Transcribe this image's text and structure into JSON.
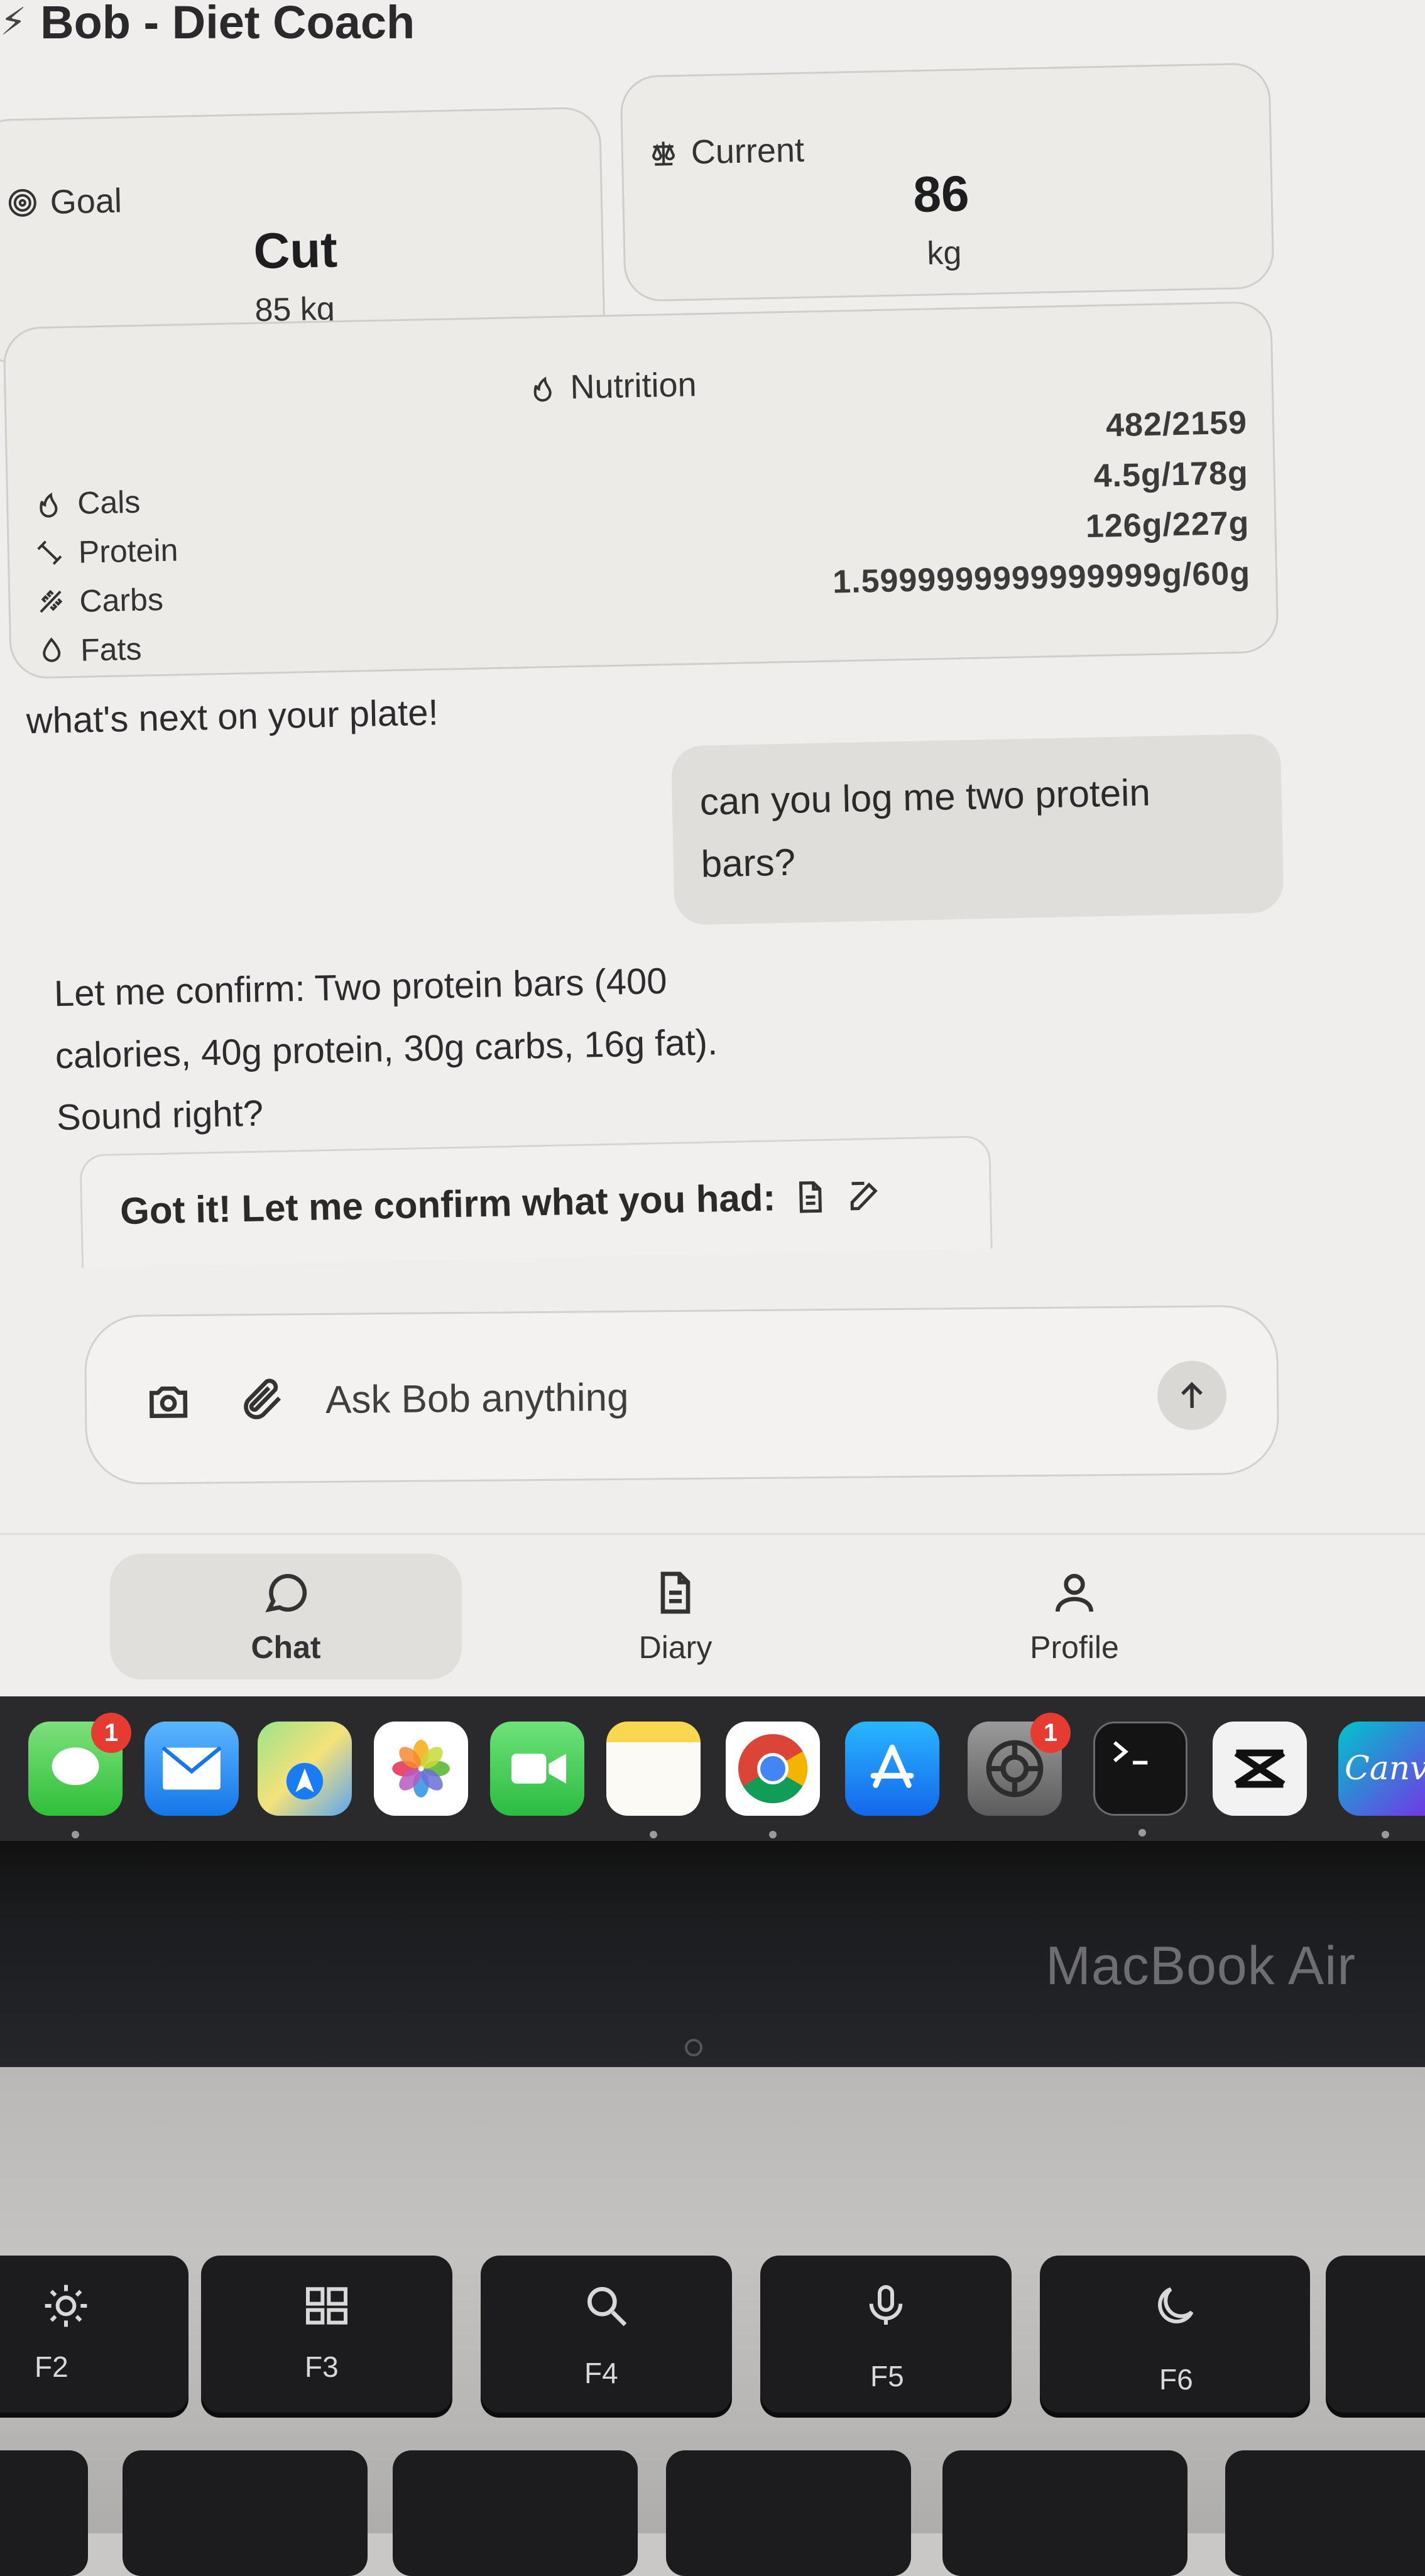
{
  "app": {
    "title": "Bob - Diet Coach"
  },
  "goal": {
    "label": "Goal",
    "value": "Cut",
    "weight": "85 kg"
  },
  "current": {
    "label": "Current",
    "value": "86",
    "unit": "kg"
  },
  "nutrition": {
    "label": "Nutrition",
    "rows": [
      {
        "name": "Cals",
        "value": "482/2159"
      },
      {
        "name": "Protein",
        "value": "4.5g/178g"
      },
      {
        "name": "Carbs",
        "value": "126g/227g"
      },
      {
        "name": "Fats",
        "value": "1.5999999999999999g/60g"
      }
    ]
  },
  "chat": {
    "partial_message": "what's next on your plate!",
    "user_message": "can you log me two protein bars?",
    "bot_message_lines": [
      "Let me confirm: Two protein bars (400",
      "calories, 40g protein, 30g carbs, 16g fat).",
      "Sound right?"
    ],
    "confirm_title": "Got it! Let me confirm what you had:"
  },
  "input": {
    "placeholder": "Ask Bob anything"
  },
  "tabs": [
    {
      "label": "Chat",
      "icon": "chat-bubble-icon",
      "active": true
    },
    {
      "label": "Diary",
      "icon": "document-icon",
      "active": false
    },
    {
      "label": "Profile",
      "icon": "person-icon",
      "active": false
    }
  ],
  "dock": {
    "apps": [
      "Messages",
      "Mail",
      "Maps",
      "Photos",
      "FaceTime",
      "Notes",
      "Chrome",
      "App Store",
      "System Settings",
      "Terminal",
      "CapCut",
      "Canva"
    ],
    "messages_badge": "1",
    "settings_badge": "1",
    "canva_label": "Canva"
  },
  "laptop": {
    "brand": "MacBook Air",
    "keys": [
      "F2",
      "F3",
      "F4",
      "F5",
      "F6"
    ]
  }
}
